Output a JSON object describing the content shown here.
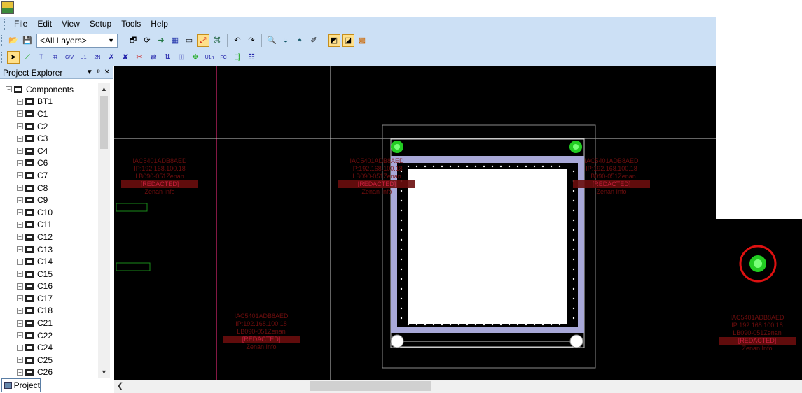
{
  "menu": [
    "File",
    "Edit",
    "View",
    "Setup",
    "Tools",
    "Help"
  ],
  "toolbar": {
    "layer_select": "<All Layers>",
    "row1_icons": [
      "open-icon",
      "save-icon",
      "properties-icon",
      "refresh-icon",
      "route-icon",
      "grid-icon",
      "display-icon",
      "route-active-icon",
      "component-icon",
      "undo-icon",
      "redo-icon",
      "zoom-icon",
      "layer-icon",
      "layer-alt-icon",
      "eraser-icon",
      "select-mode-icon",
      "board-mode-icon",
      "pattern-icon"
    ],
    "row2_icons": [
      "select-arrow-icon",
      "add-trace-icon",
      "add-via-icon",
      "add-copper-icon",
      "gnd-vcc-icon",
      "u1-u2-icon",
      "net-icon",
      "cross-icon",
      "cross-alt-icon",
      "cut-icon",
      "route-net-icon",
      "pin-swap-icon",
      "component-place-icon",
      "move-icon",
      "u1n-icon",
      "fc-icon",
      "nets-icon",
      "table-icon"
    ]
  },
  "explorer": {
    "title": "Project Explorer",
    "root": "Components",
    "items": [
      "BT1",
      "C1",
      "C2",
      "C3",
      "C4",
      "C6",
      "C7",
      "C8",
      "C9",
      "C10",
      "C11",
      "C12",
      "C13",
      "C14",
      "C15",
      "C16",
      "C17",
      "C18",
      "C21",
      "C22",
      "C24",
      "C25",
      "C26"
    ],
    "tab": "Project"
  },
  "watermark": {
    "lines": [
      "IAC5401ADB8AED",
      "IP:192.168.100.18",
      "LB090-051Zenan",
      "[REDACTED]",
      "Zenan Info"
    ]
  },
  "colors": {
    "canvas": "#000000",
    "board": "#a8a8d8",
    "pad": "#22dd22",
    "highlight_ring": "#dd1111",
    "chrome": "#cce0f5"
  }
}
